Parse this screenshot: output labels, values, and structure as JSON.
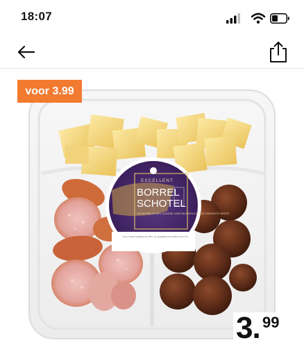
{
  "status_bar": {
    "time": "18:07"
  },
  "nav": {
    "back_icon": "arrow-left-icon",
    "share_icon": "share-icon"
  },
  "promo": {
    "label": "voor 3.99",
    "color": "#f27b30"
  },
  "product_label": {
    "brand": "EXCELLENT",
    "title_line1": "BORREL",
    "title_line2": "SCHOTEL",
    "description": "GEHAKTBALLETJES, GOUDSE JONG BELEGEN KAAS EN GEROOKTE WORST",
    "footer": "Tien minuten houdbaar bij -18°C, zie verpakking voor datum, kort (7°C)",
    "brand_color": "#4a2a6e"
  },
  "price": {
    "integer": "3.",
    "decimal": "99"
  }
}
